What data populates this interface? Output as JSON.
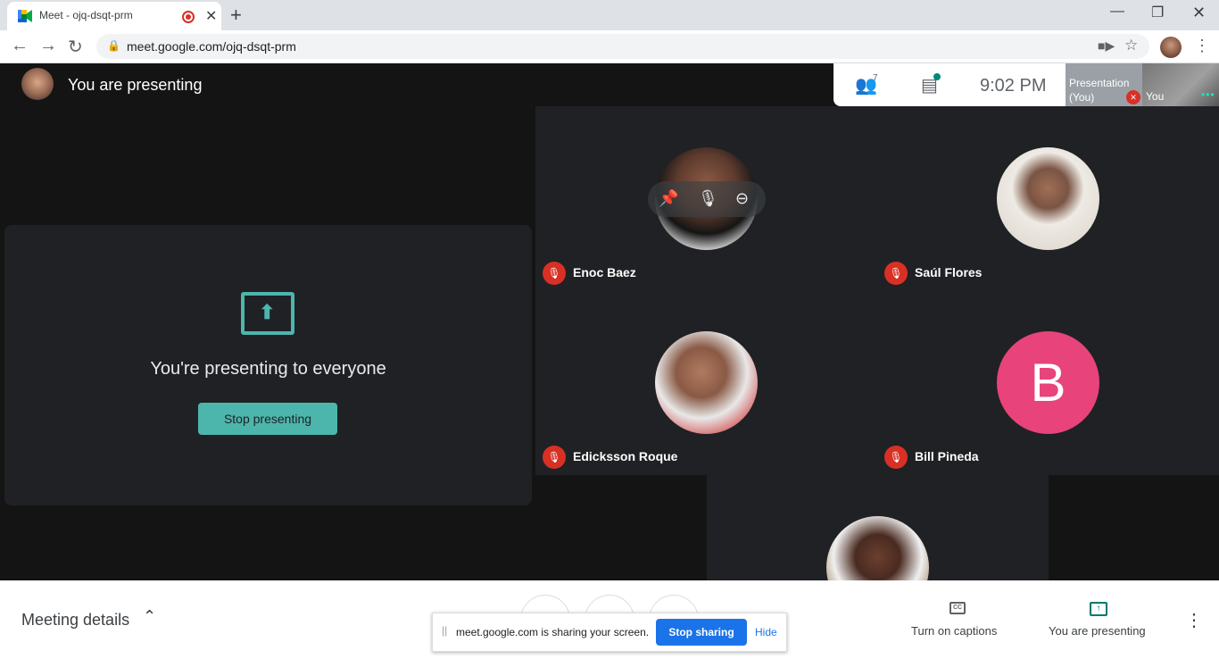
{
  "browser": {
    "tab_title": "Meet - ojq-dsqt-prm",
    "url": "meet.google.com/ojq-dsqt-prm",
    "icons": {
      "back": "back-arrow-icon",
      "forward": "forward-arrow-icon",
      "reload": "reload-icon",
      "new_tab": "plus-icon",
      "minimize": "minimize-icon",
      "maximize": "restore-icon",
      "close": "close-icon"
    }
  },
  "meet": {
    "presenting_title": "You are presenting",
    "people_count": "7",
    "time": "9:02  PM",
    "mini_presentation_label": "Presentation (You)",
    "mini_you_label": "You",
    "present_message": "You're presenting to everyone",
    "stop_presenting": "Stop presenting",
    "participants": [
      {
        "name": "Enoc Baez",
        "muted": true
      },
      {
        "name": "Saúl Flores",
        "muted": true
      },
      {
        "name": "Edicksson Roque",
        "muted": true
      },
      {
        "name": "Bill Pineda",
        "muted": true,
        "initial": "B"
      }
    ]
  },
  "bottom": {
    "meeting_details": "Meeting details",
    "captions": "Turn on captions",
    "you_are_presenting": "You are presenting"
  },
  "share_banner": {
    "message": "meet.google.com is sharing your screen.",
    "stop_sharing": "Stop sharing",
    "hide": "Hide"
  },
  "colors": {
    "accent_teal": "#4db6ac",
    "mute_red": "#d93025",
    "bill_avatar": "#e8437a",
    "share_blue": "#1a73e8"
  }
}
